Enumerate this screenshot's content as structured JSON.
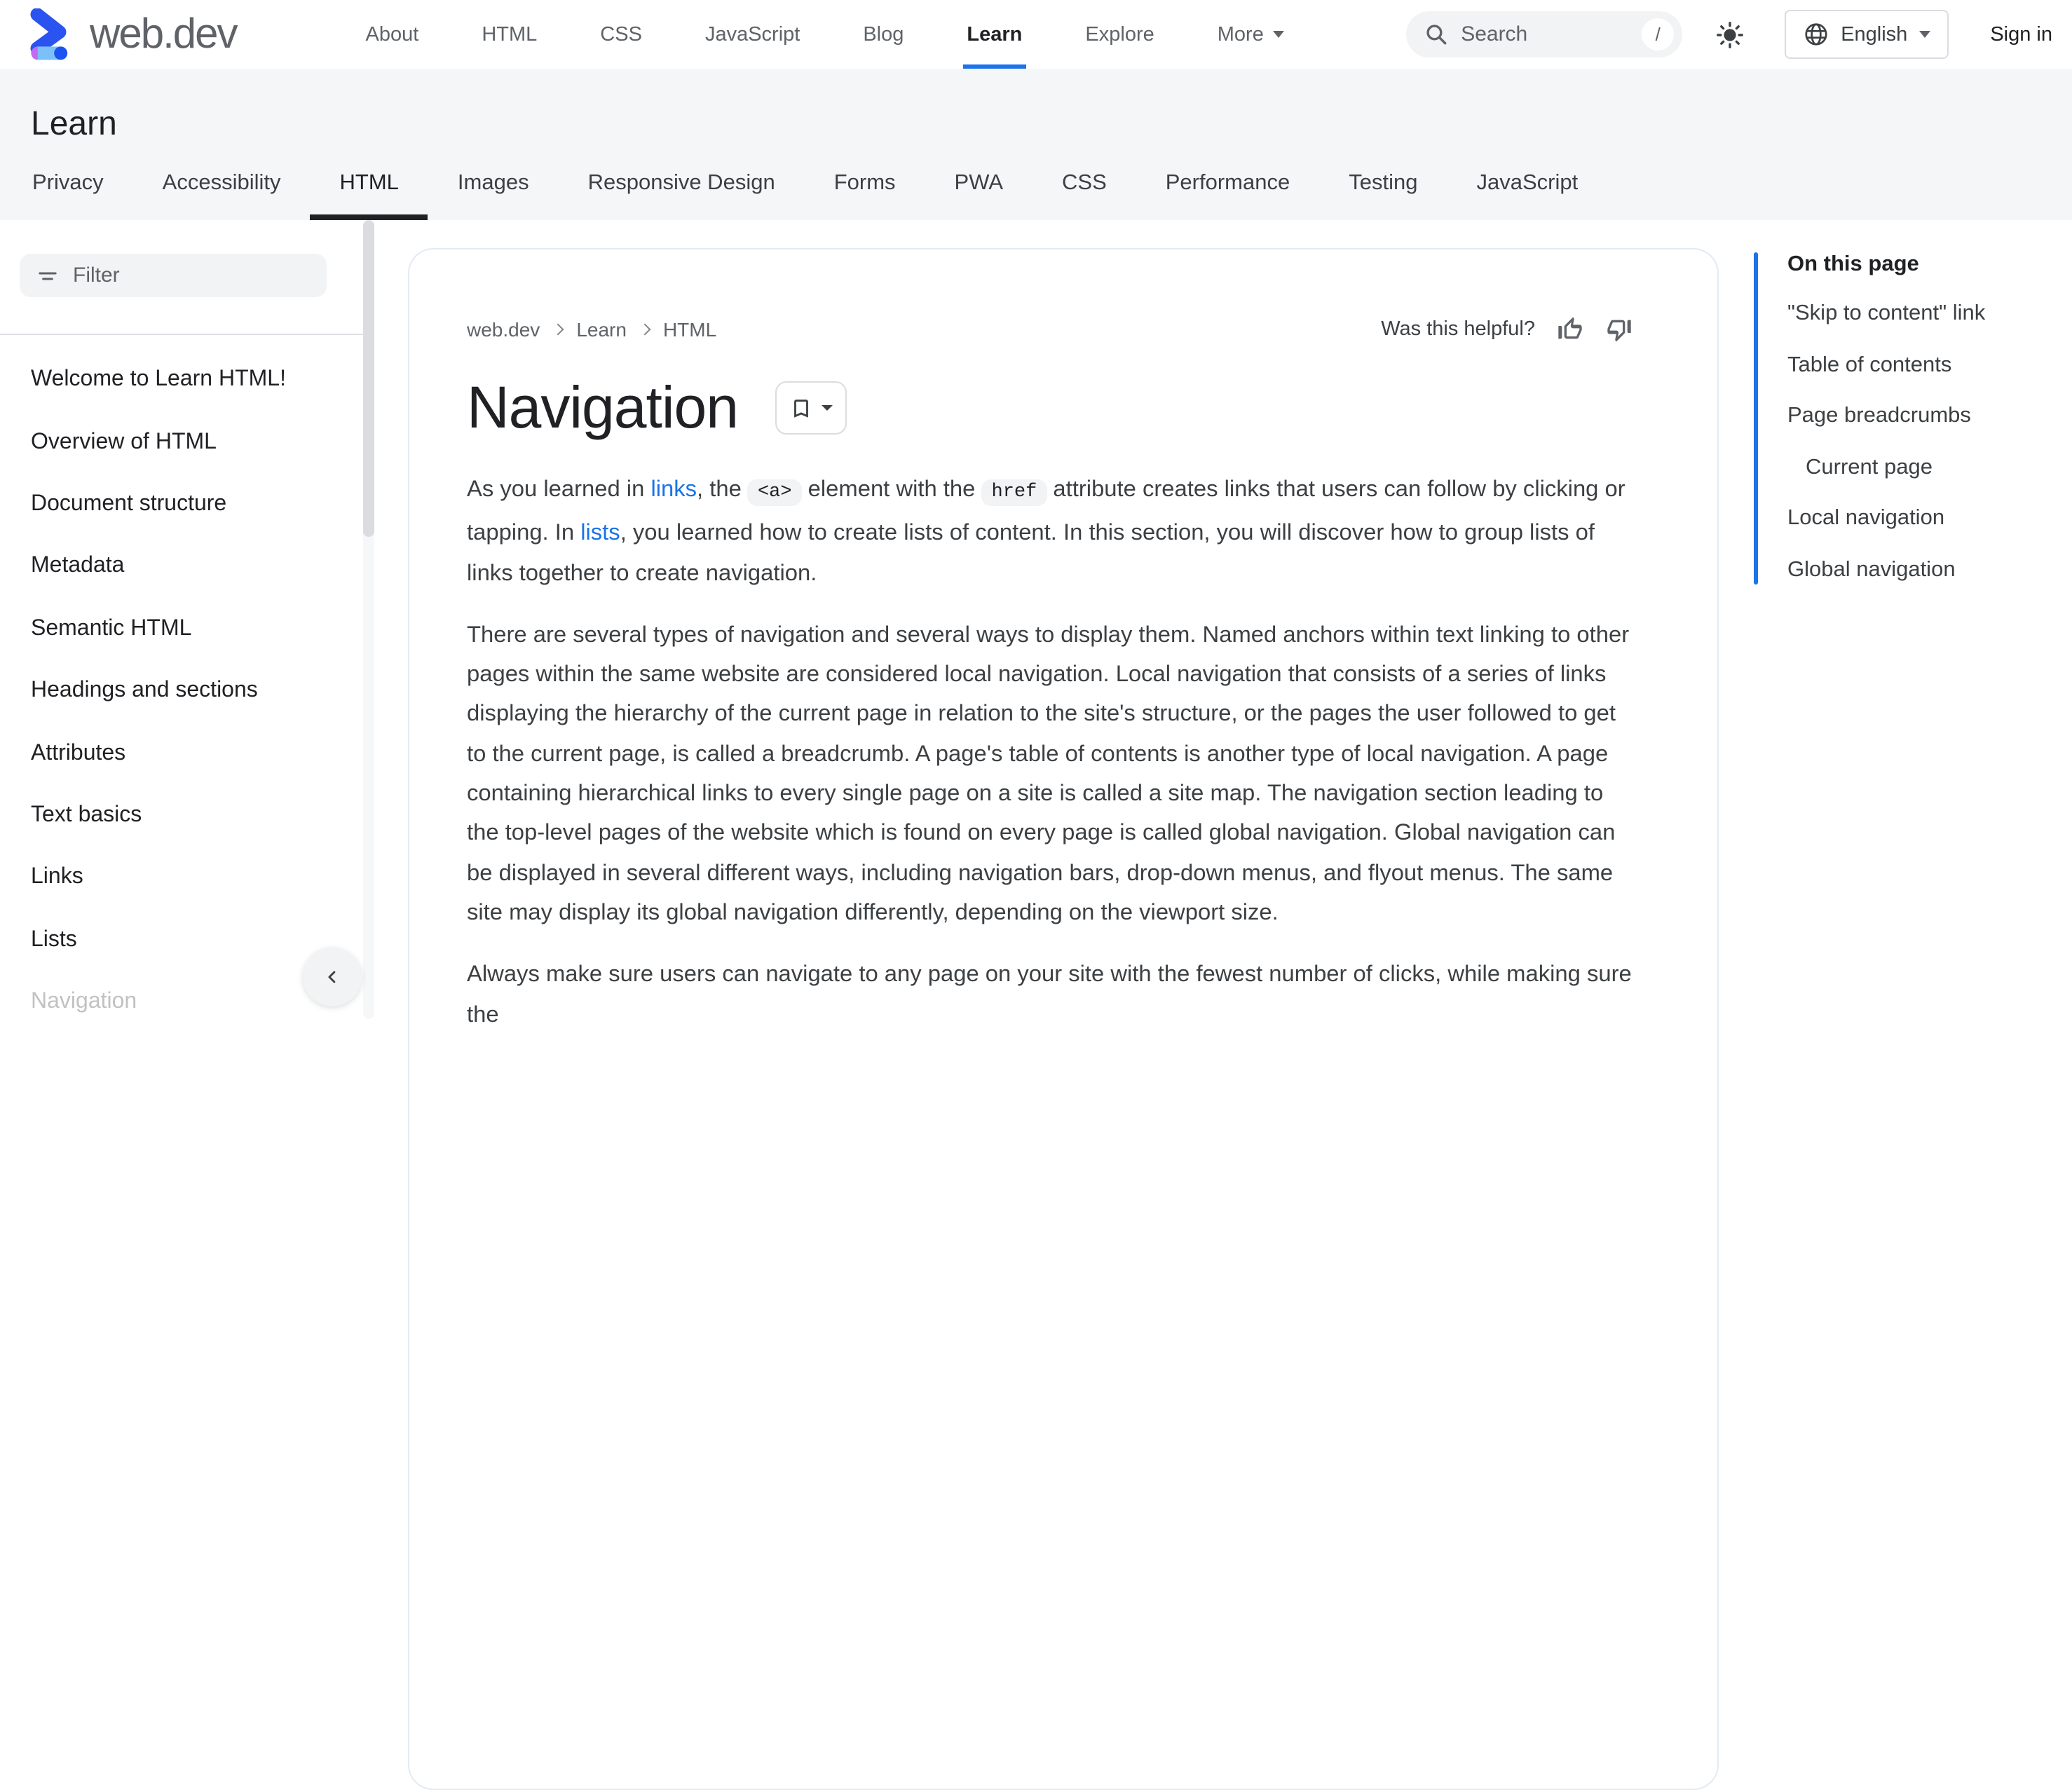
{
  "topnav": {
    "logo_text": "web.dev",
    "links": [
      {
        "label": "About"
      },
      {
        "label": "HTML"
      },
      {
        "label": "CSS"
      },
      {
        "label": "JavaScript"
      },
      {
        "label": "Blog"
      },
      {
        "label": "Learn",
        "active": true
      },
      {
        "label": "Explore"
      },
      {
        "label": "More",
        "dropdown": true
      }
    ],
    "search": {
      "placeholder": "Search",
      "shortcut_key": "/"
    },
    "language": "English",
    "sign_in_label": "Sign in"
  },
  "hero": {
    "title": "Learn",
    "tabs": [
      {
        "label": "Privacy"
      },
      {
        "label": "Accessibility"
      },
      {
        "label": "HTML",
        "active": true
      },
      {
        "label": "Images"
      },
      {
        "label": "Responsive Design"
      },
      {
        "label": "Forms"
      },
      {
        "label": "PWA"
      },
      {
        "label": "CSS"
      },
      {
        "label": "Performance"
      },
      {
        "label": "Testing"
      },
      {
        "label": "JavaScript"
      }
    ]
  },
  "sidebar": {
    "filter_placeholder": "Filter",
    "items": [
      {
        "label": "Welcome to Learn HTML!"
      },
      {
        "label": "Overview of HTML"
      },
      {
        "label": "Document structure"
      },
      {
        "label": "Metadata"
      },
      {
        "label": "Semantic HTML"
      },
      {
        "label": "Headings and sections"
      },
      {
        "label": "Attributes"
      },
      {
        "label": "Text basics"
      },
      {
        "label": "Links"
      },
      {
        "label": "Lists"
      },
      {
        "label": "Navigation",
        "faded": true
      }
    ]
  },
  "article": {
    "breadcrumbs": [
      "web.dev",
      "Learn",
      "HTML"
    ],
    "feedback_label": "Was this helpful?",
    "title": "Navigation",
    "paragraphs": [
      [
        {
          "text": "As you learned in "
        },
        {
          "text": "links",
          "type": "link"
        },
        {
          "text": ", the "
        },
        {
          "text": "<a>",
          "type": "code"
        },
        {
          "text": " element with the "
        },
        {
          "text": "href",
          "type": "code"
        },
        {
          "text": " attribute creates links that users can follow by clicking or tapping. In "
        },
        {
          "text": "lists",
          "type": "link"
        },
        {
          "text": ", you learned how to create lists of content. In this section, you will discover how to group lists of links together to create navigation."
        }
      ],
      [
        {
          "text": "There are several types of navigation and several ways to display them. Named anchors within text linking to other pages within the same website are considered local navigation. Local navigation that consists of a series of links displaying the hierarchy of the current page in relation to the site's structure, or the pages the user followed to get to the current page, is called a breadcrumb. A page's table of contents is another type of local navigation. A page containing hierarchical links to every single page on a site is called a site map. The navigation section leading to the top-level pages of the website which is found on every page is called global navigation. Global navigation can be displayed in several different ways, including navigation bars, drop-down menus, and flyout menus. The same site may display its global navigation differently, depending on the viewport size."
        }
      ],
      [
        {
          "text": "Always make sure users can navigate to any page on your site with the fewest number of clicks, while making sure the"
        }
      ]
    ]
  },
  "toc": {
    "heading": "On this page",
    "items": [
      {
        "label": "\"Skip to content\" link"
      },
      {
        "label": "Table of contents"
      },
      {
        "label": "Page breadcrumbs"
      },
      {
        "label": "Current page",
        "indent": true
      },
      {
        "label": "Local navigation"
      },
      {
        "label": "Global navigation"
      }
    ]
  },
  "colors": {
    "accent_blue": "#1a73e8",
    "active_dark": "#202124",
    "body_text": "#3c4043",
    "muted_text": "#5f6368",
    "code_bg": "#f1f3f4",
    "hero_bg": "#f4f6f8",
    "card_border": "#e3eaf3"
  }
}
